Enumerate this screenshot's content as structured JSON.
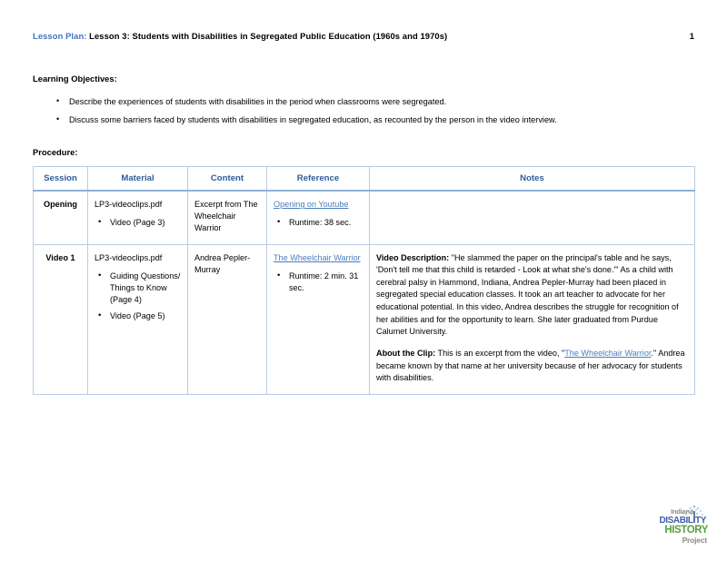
{
  "header": {
    "label": "Lesson Plan:",
    "title": " Lesson 3: Students with Disabilities in Segregated Public Education (1960s and 1970s)",
    "page_number": "1"
  },
  "sections": {
    "learning_objectives_heading": "Learning Objectives:",
    "procedure_heading": "Procedure:"
  },
  "learning_objectives": [
    "Describe the experiences of students with disabilities in the period when classrooms were segregated.",
    "Discuss some barriers faced by students with disabilities in segregated education, as recounted by the person in the video interview."
  ],
  "table": {
    "columns": [
      "Session",
      "Material",
      "Content",
      "Reference",
      "Notes"
    ],
    "rows": [
      {
        "session": "Opening",
        "material": "LP3-videoclips.pdf",
        "material_items": [
          "Video (Page 3)"
        ],
        "content": "Excerpt from The Wheelchair Warrior",
        "reference_link": "Opening on Youtube",
        "reference_items": [
          "Runtime: 38 sec."
        ],
        "notes": ""
      },
      {
        "session": "Video 1",
        "material": "LP3-videoclips.pdf",
        "material_items": [
          "Guiding Questions/ Things to Know (Page 4)",
          "Video (Page 5)"
        ],
        "content": "Andrea Pepler-Murray",
        "reference_link": "The Wheelchair Warrior",
        "reference_items": [
          "Runtime: 2 min. 31 sec."
        ],
        "notes_video_lead": "Video Description:",
        "notes_video_body": " \"He slammed the paper on the principal's table and he says, 'Don't tell me that this child is retarded - Look at what she's done.'\" As a child with cerebral palsy in Hammond, Indiana, Andrea Pepler-Murray had been placed in segregated special education classes. It took an art teacher to advocate for her educational potential. In this video, Andrea describes the struggle for recognition of her abilities and for the opportunity to learn. She later graduated from Purdue Calumet University.",
        "notes_clip_lead": "About the Clip:",
        "notes_clip_body_before": " This is an excerpt from the video, \"",
        "notes_clip_link": "The Wheelchair Warrior",
        "notes_clip_body_after": ".\" Andrea became known by that name at her university because of her advocacy for students with disabilities."
      }
    ]
  },
  "footer_logo": {
    "line1": "Indiana",
    "line2": "DISABILITY",
    "line3": "HISTORY",
    "line4": "Project"
  },
  "colors": {
    "heading_blue": "#4472c4",
    "table_header_blue": "#2e5c9a",
    "link_blue": "#4a7ebb",
    "border_blue": "#b8cce4",
    "logo_green": "#5a9e46",
    "logo_blue": "#3f5fa8",
    "logo_gray": "#8a8d7f"
  }
}
